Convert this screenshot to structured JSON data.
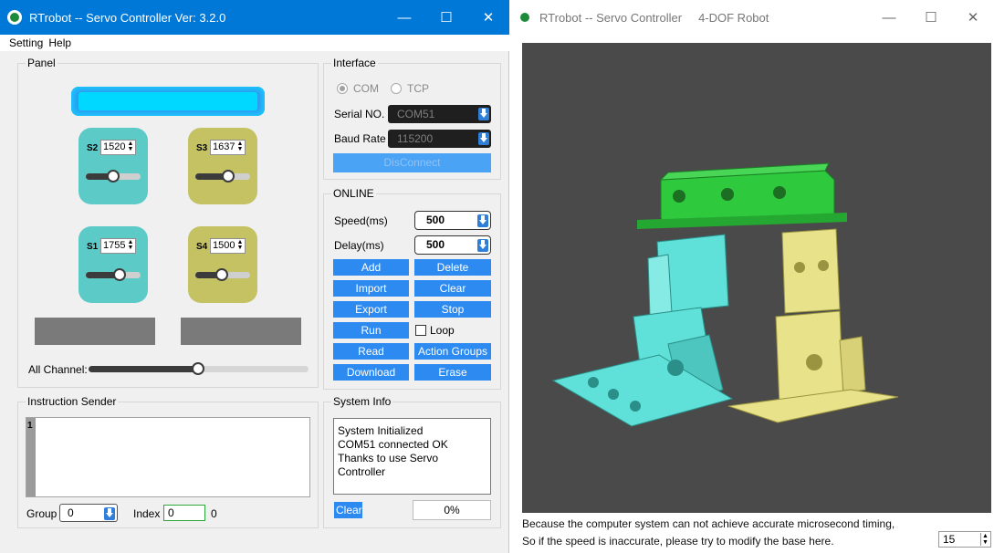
{
  "controller": {
    "title": "RTrobot -- Servo Controller  Ver: 3.2.0",
    "window_buttons": {
      "minimize": "—",
      "maximize": "☐",
      "close": "✕"
    },
    "menu": [
      "Setting",
      "Help"
    ],
    "panel": {
      "title": "Panel",
      "servos": [
        {
          "label": "S2",
          "value": "1520",
          "slider_fraction": 0.5,
          "color": "#5ccbc8"
        },
        {
          "label": "S3",
          "value": "1637",
          "slider_fraction": 0.6,
          "color": "#c4c262"
        },
        {
          "label": "S1",
          "value": "1755",
          "slider_fraction": 0.62,
          "color": "#5ccbc8"
        },
        {
          "label": "S4",
          "value": "1500",
          "slider_fraction": 0.48,
          "color": "#c4c262"
        }
      ],
      "all_channel_label": "All Channel:",
      "all_channel_fraction": 0.5
    },
    "interface": {
      "title": "Interface",
      "com_label": "COM",
      "tcp_label": "TCP",
      "selected": "COM",
      "serial_label": "Serial NO.",
      "serial_value": "COM51",
      "baud_label": "Baud Rate",
      "baud_value": "115200",
      "disconnect_label": "DisConnect"
    },
    "online": {
      "title": "ONLINE",
      "speed_label": "Speed(ms)",
      "speed_value": "500",
      "delay_label": "Delay(ms)",
      "delay_value": "500",
      "buttons": {
        "add": "Add",
        "delete": "Delete",
        "import": "Import",
        "clear": "Clear",
        "export": "Export",
        "stop": "Stop",
        "run": "Run",
        "loop": "Loop",
        "read": "Read",
        "action_groups": "Action Groups",
        "download": "Download",
        "erase": "Erase"
      },
      "loop_checked": false
    },
    "instruction_sender": {
      "title": "Instruction Sender",
      "line_number": "1",
      "group_label": "Group",
      "group_value": "0",
      "index_label": "Index",
      "index_value": "0",
      "index_total": "0"
    },
    "system_info": {
      "title": "System Info",
      "lines": [
        "System Initialized",
        "COM51 connected OK",
        "Thanks to use Servo",
        "Controller"
      ],
      "clear_label": "Clear",
      "progress_text": "0%"
    },
    "colors": {
      "accent": "#2d8af0",
      "cyan": "#5ccbc8",
      "olive": "#c4c262"
    }
  },
  "viewer": {
    "title": "RTrobot -- Servo Controller",
    "subtitle": "4-DOF Robot",
    "window_buttons": {
      "minimize": "—",
      "maximize": "☐",
      "close": "✕"
    },
    "note_line1": "Because the computer system can not achieve accurate microsecond timing,",
    "note_line2": "So if the speed is inaccurate, please try to modify the base here.",
    "base_value": "15",
    "colors": {
      "viewport": "#4a4a4a",
      "top_plate": "#2fc93d",
      "left_leg": "#5fe0d8",
      "right_leg": "#e8e28a"
    }
  }
}
